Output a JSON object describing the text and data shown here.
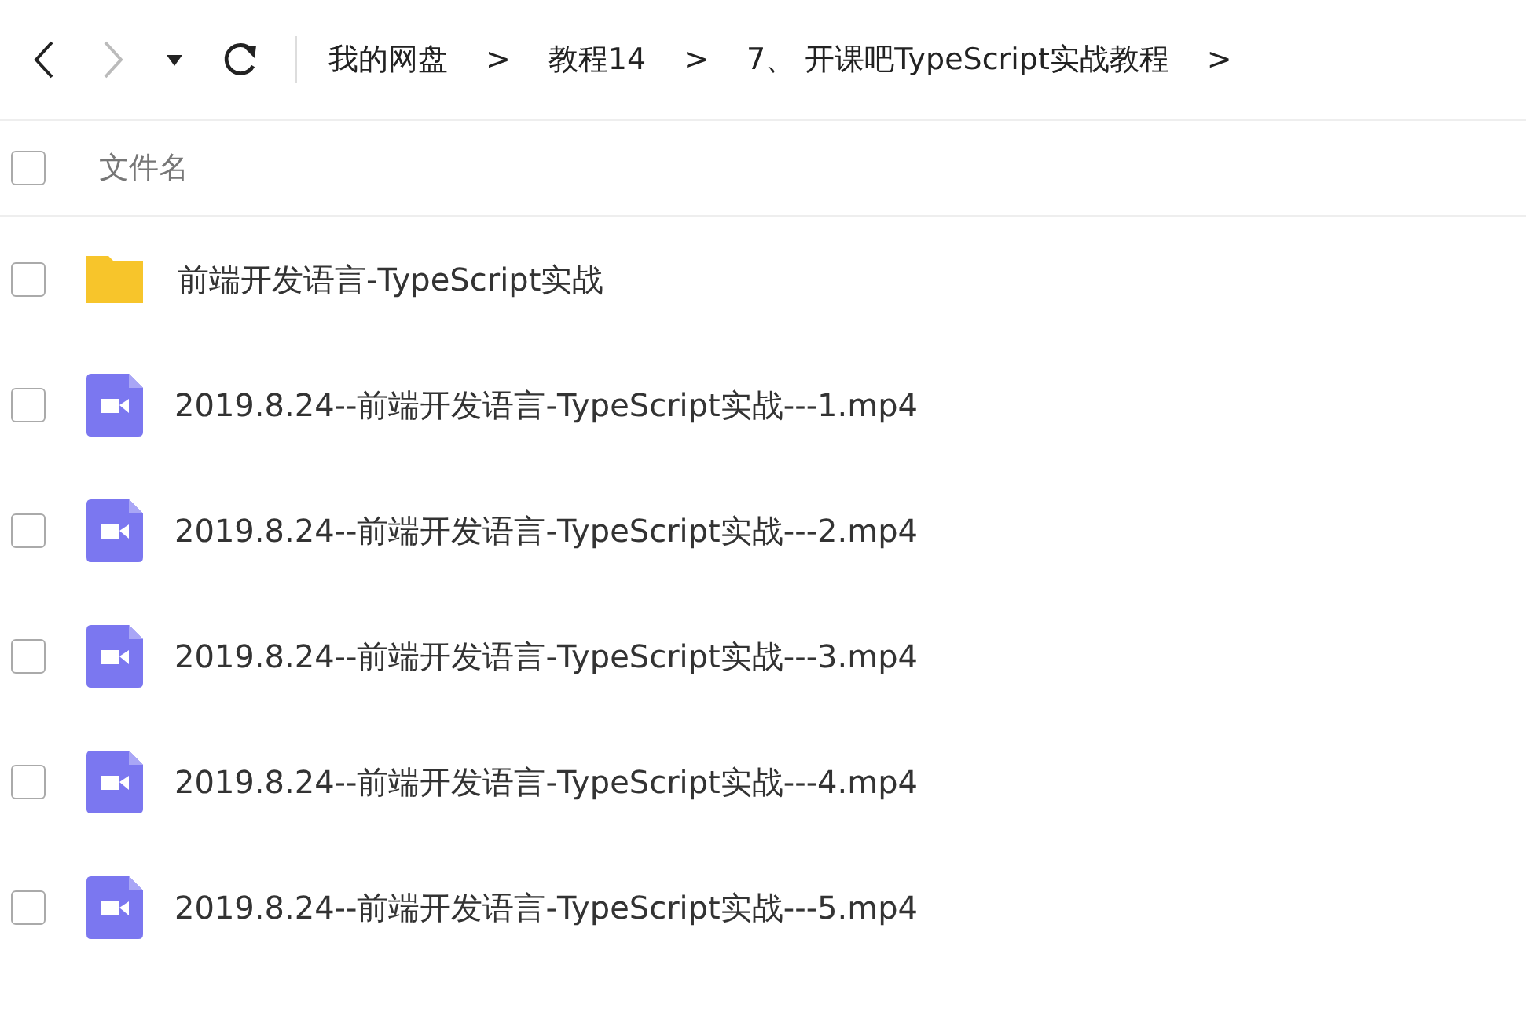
{
  "toolbar": {
    "back_disabled": false,
    "forward_disabled": true
  },
  "breadcrumb": [
    {
      "label": "我的网盘",
      "separator": ">"
    },
    {
      "label": "教程14",
      "separator": ">"
    },
    {
      "label": "7、 开课吧TypeScript实战教程",
      "separator": ">"
    }
  ],
  "header": {
    "checked": false,
    "column_label": "文件名"
  },
  "files": [
    {
      "kind": "folder",
      "name": "前端开发语言-TypeScript实战",
      "checked": false
    },
    {
      "kind": "video",
      "name": "2019.8.24--前端开发语言-TypeScript实战---1.mp4",
      "checked": false
    },
    {
      "kind": "video",
      "name": "2019.8.24--前端开发语言-TypeScript实战---2.mp4",
      "checked": false
    },
    {
      "kind": "video",
      "name": "2019.8.24--前端开发语言-TypeScript实战---3.mp4",
      "checked": false
    },
    {
      "kind": "video",
      "name": "2019.8.24--前端开发语言-TypeScript实战---4.mp4",
      "checked": false
    },
    {
      "kind": "video",
      "name": "2019.8.24--前端开发语言-TypeScript实战---5.mp4",
      "checked": false
    }
  ]
}
